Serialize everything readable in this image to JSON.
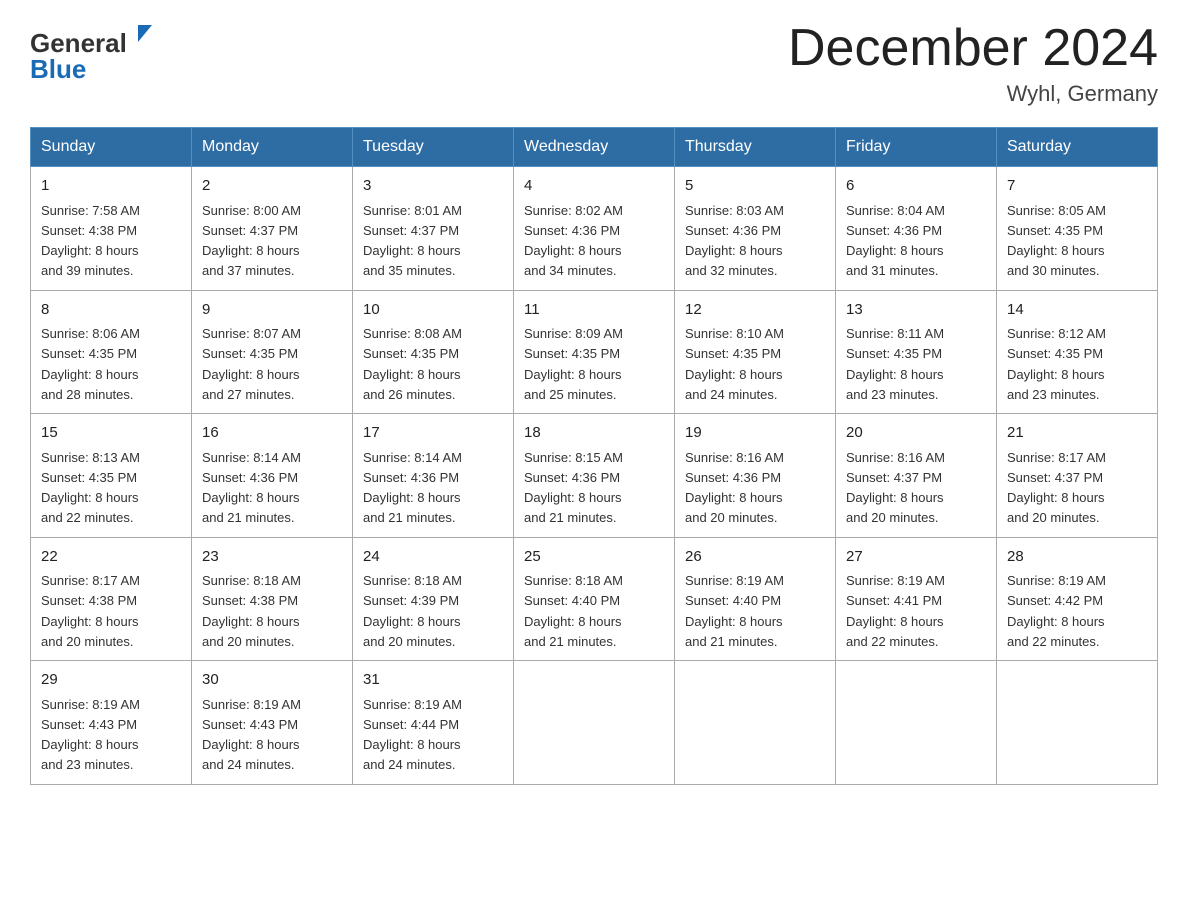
{
  "header": {
    "logo_general": "General",
    "logo_blue": "Blue",
    "month_title": "December 2024",
    "location": "Wyhl, Germany"
  },
  "weekdays": [
    "Sunday",
    "Monday",
    "Tuesday",
    "Wednesday",
    "Thursday",
    "Friday",
    "Saturday"
  ],
  "weeks": [
    [
      {
        "day": "1",
        "sunrise": "7:58 AM",
        "sunset": "4:38 PM",
        "daylight": "8 hours and 39 minutes."
      },
      {
        "day": "2",
        "sunrise": "8:00 AM",
        "sunset": "4:37 PM",
        "daylight": "8 hours and 37 minutes."
      },
      {
        "day": "3",
        "sunrise": "8:01 AM",
        "sunset": "4:37 PM",
        "daylight": "8 hours and 35 minutes."
      },
      {
        "day": "4",
        "sunrise": "8:02 AM",
        "sunset": "4:36 PM",
        "daylight": "8 hours and 34 minutes."
      },
      {
        "day": "5",
        "sunrise": "8:03 AM",
        "sunset": "4:36 PM",
        "daylight": "8 hours and 32 minutes."
      },
      {
        "day": "6",
        "sunrise": "8:04 AM",
        "sunset": "4:36 PM",
        "daylight": "8 hours and 31 minutes."
      },
      {
        "day": "7",
        "sunrise": "8:05 AM",
        "sunset": "4:35 PM",
        "daylight": "8 hours and 30 minutes."
      }
    ],
    [
      {
        "day": "8",
        "sunrise": "8:06 AM",
        "sunset": "4:35 PM",
        "daylight": "8 hours and 28 minutes."
      },
      {
        "day": "9",
        "sunrise": "8:07 AM",
        "sunset": "4:35 PM",
        "daylight": "8 hours and 27 minutes."
      },
      {
        "day": "10",
        "sunrise": "8:08 AM",
        "sunset": "4:35 PM",
        "daylight": "8 hours and 26 minutes."
      },
      {
        "day": "11",
        "sunrise": "8:09 AM",
        "sunset": "4:35 PM",
        "daylight": "8 hours and 25 minutes."
      },
      {
        "day": "12",
        "sunrise": "8:10 AM",
        "sunset": "4:35 PM",
        "daylight": "8 hours and 24 minutes."
      },
      {
        "day": "13",
        "sunrise": "8:11 AM",
        "sunset": "4:35 PM",
        "daylight": "8 hours and 23 minutes."
      },
      {
        "day": "14",
        "sunrise": "8:12 AM",
        "sunset": "4:35 PM",
        "daylight": "8 hours and 23 minutes."
      }
    ],
    [
      {
        "day": "15",
        "sunrise": "8:13 AM",
        "sunset": "4:35 PM",
        "daylight": "8 hours and 22 minutes."
      },
      {
        "day": "16",
        "sunrise": "8:14 AM",
        "sunset": "4:36 PM",
        "daylight": "8 hours and 21 minutes."
      },
      {
        "day": "17",
        "sunrise": "8:14 AM",
        "sunset": "4:36 PM",
        "daylight": "8 hours and 21 minutes."
      },
      {
        "day": "18",
        "sunrise": "8:15 AM",
        "sunset": "4:36 PM",
        "daylight": "8 hours and 21 minutes."
      },
      {
        "day": "19",
        "sunrise": "8:16 AM",
        "sunset": "4:36 PM",
        "daylight": "8 hours and 20 minutes."
      },
      {
        "day": "20",
        "sunrise": "8:16 AM",
        "sunset": "4:37 PM",
        "daylight": "8 hours and 20 minutes."
      },
      {
        "day": "21",
        "sunrise": "8:17 AM",
        "sunset": "4:37 PM",
        "daylight": "8 hours and 20 minutes."
      }
    ],
    [
      {
        "day": "22",
        "sunrise": "8:17 AM",
        "sunset": "4:38 PM",
        "daylight": "8 hours and 20 minutes."
      },
      {
        "day": "23",
        "sunrise": "8:18 AM",
        "sunset": "4:38 PM",
        "daylight": "8 hours and 20 minutes."
      },
      {
        "day": "24",
        "sunrise": "8:18 AM",
        "sunset": "4:39 PM",
        "daylight": "8 hours and 20 minutes."
      },
      {
        "day": "25",
        "sunrise": "8:18 AM",
        "sunset": "4:40 PM",
        "daylight": "8 hours and 21 minutes."
      },
      {
        "day": "26",
        "sunrise": "8:19 AM",
        "sunset": "4:40 PM",
        "daylight": "8 hours and 21 minutes."
      },
      {
        "day": "27",
        "sunrise": "8:19 AM",
        "sunset": "4:41 PM",
        "daylight": "8 hours and 22 minutes."
      },
      {
        "day": "28",
        "sunrise": "8:19 AM",
        "sunset": "4:42 PM",
        "daylight": "8 hours and 22 minutes."
      }
    ],
    [
      {
        "day": "29",
        "sunrise": "8:19 AM",
        "sunset": "4:43 PM",
        "daylight": "8 hours and 23 minutes."
      },
      {
        "day": "30",
        "sunrise": "8:19 AM",
        "sunset": "4:43 PM",
        "daylight": "8 hours and 24 minutes."
      },
      {
        "day": "31",
        "sunrise": "8:19 AM",
        "sunset": "4:44 PM",
        "daylight": "8 hours and 24 minutes."
      },
      null,
      null,
      null,
      null
    ]
  ],
  "labels": {
    "sunrise": "Sunrise:",
    "sunset": "Sunset:",
    "daylight": "Daylight:"
  }
}
